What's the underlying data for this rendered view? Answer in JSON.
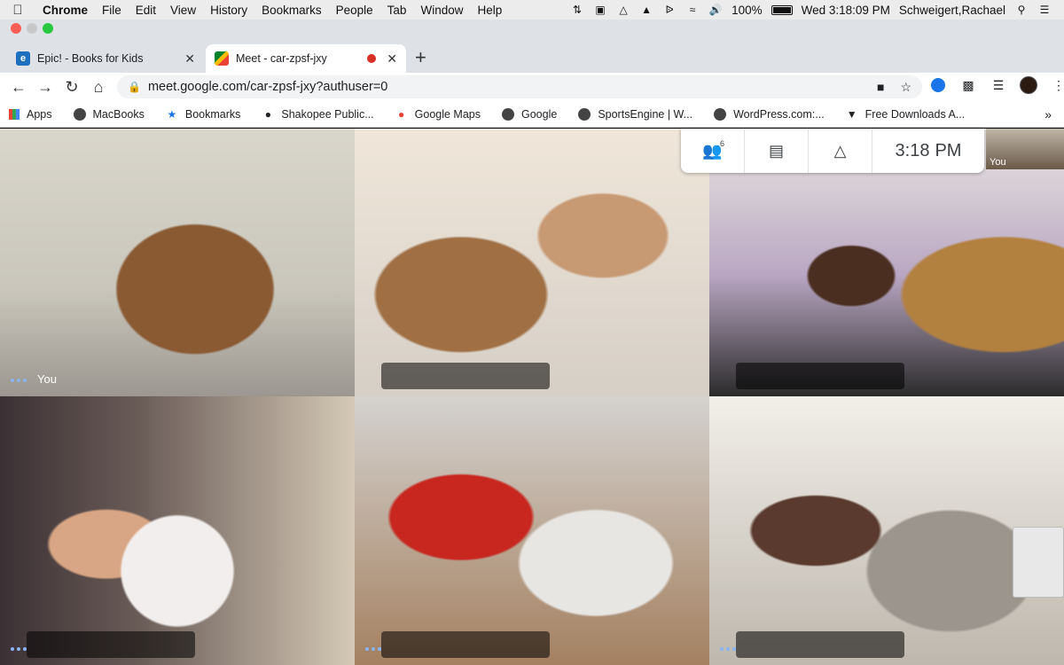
{
  "menubar": {
    "app": "Chrome",
    "items": [
      "File",
      "Edit",
      "View",
      "History",
      "Bookmarks",
      "People",
      "Tab",
      "Window",
      "Help"
    ],
    "battery": "100%",
    "datetime": "Wed 3:18:09 PM",
    "user": "Schweigert,Rachael"
  },
  "tabs": [
    {
      "title": "Epic! - Books for Kids",
      "icon": "epic-icon",
      "active": false
    },
    {
      "title": "Meet - car-zpsf-jxy",
      "icon": "meet-icon",
      "active": true,
      "recording": true
    }
  ],
  "toolbar": {
    "url": "meet.google.com/car-zpsf-jxy?authuser=0"
  },
  "bookmarks": [
    {
      "label": "Apps",
      "icon": "apps-grid-icon"
    },
    {
      "label": "MacBooks",
      "icon": "globe-icon"
    },
    {
      "label": "Bookmarks",
      "icon": "star-icon"
    },
    {
      "label": "Shakopee Public...",
      "icon": "school-icon"
    },
    {
      "label": "Google Maps",
      "icon": "maps-pin-icon"
    },
    {
      "label": "Google",
      "icon": "globe-icon"
    },
    {
      "label": "SportsEngine | W...",
      "icon": "globe-icon"
    },
    {
      "label": "WordPress.com:...",
      "icon": "globe-icon"
    },
    {
      "label": "Free Downloads A...",
      "icon": "download-icon"
    }
  ],
  "meet": {
    "participant_count": "6",
    "time": "3:18",
    "ampm": "PM",
    "self_label": "You",
    "tiles": [
      {
        "name": "You"
      },
      {
        "name": ""
      },
      {
        "name": ""
      },
      {
        "name": ""
      },
      {
        "name": ""
      },
      {
        "name": ""
      }
    ]
  }
}
